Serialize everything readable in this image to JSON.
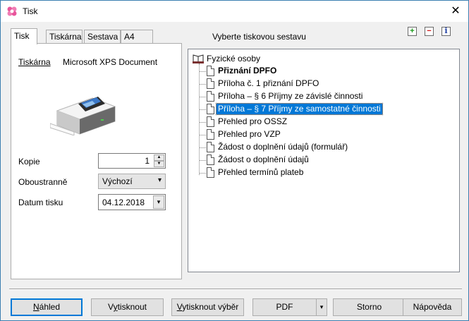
{
  "window": {
    "title": "Tisk"
  },
  "tabs": [
    {
      "label": "Tisk"
    },
    {
      "label": "Tiskárna"
    },
    {
      "label": "Sestava"
    },
    {
      "label": "A4"
    }
  ],
  "printer": {
    "label": "Tiskárna",
    "name": "Microsoft XPS Document"
  },
  "form": {
    "copies_label": "Kopie",
    "copies_value": "1",
    "duplex_label": "Oboustranně",
    "duplex_value": "Výchozí",
    "date_label": "Datum tisku",
    "date_value": "04.12.2018"
  },
  "report_section": {
    "title": "Vyberte tiskovou sestavu"
  },
  "tree": {
    "root": "Fyzické osoby",
    "items": [
      {
        "label": "Přiznání DPFO"
      },
      {
        "label": "Příloha č. 1 přiznání DPFO"
      },
      {
        "label": "Příloha – § 6 Příjmy ze závislé činnosti"
      },
      {
        "label": "Příloha – § 7 Příjmy ze samostatné činnosti"
      },
      {
        "label": "Přehled pro OSSZ"
      },
      {
        "label": "Přehled pro VZP"
      },
      {
        "label": "Žádost o doplnění údajů (formulář)"
      },
      {
        "label": "Žádost o doplnění údajů"
      },
      {
        "label": "Přehled termínů plateb"
      }
    ]
  },
  "buttons": {
    "preview_ul": "N",
    "preview_rest": "áhled",
    "print_pre": "V",
    "print_ul": "y",
    "print_rest": "tisknout",
    "print_sel_ul": "V",
    "print_sel_rest": "ytisknout výběr",
    "pdf": "PDF",
    "cancel": "Storno",
    "help": "Nápověda"
  },
  "colors": {
    "selection": "#0078d7",
    "default_button_border": "#0078d7"
  }
}
